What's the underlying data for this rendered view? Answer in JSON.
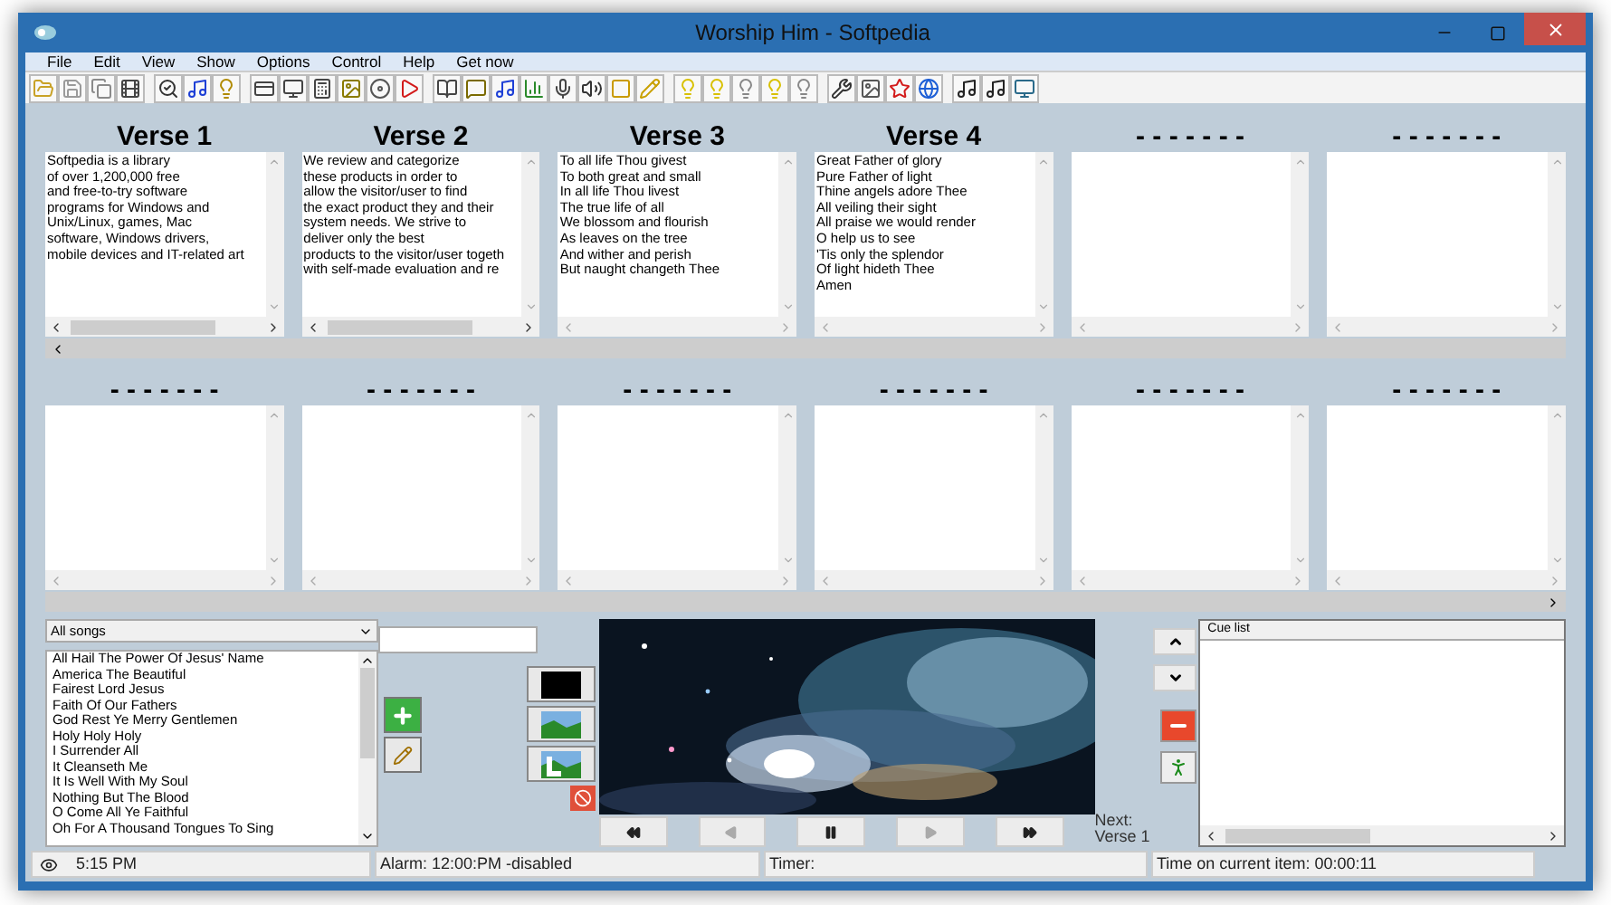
{
  "window": {
    "title": "Worship Him -  Softpedia"
  },
  "menu": [
    "File",
    "Edit",
    "View",
    "Show",
    "Options",
    "Control",
    "Help",
    "Get now"
  ],
  "verses": [
    {
      "title": "Verse 1",
      "lines": [
        "Softpedia is a library",
        "of over 1,200,000 free",
        "and free-to-try software",
        "programs for Windows and",
        "Unix/Linux, games, Mac",
        "software, Windows drivers,",
        "mobile devices and IT-related art"
      ]
    },
    {
      "title": "Verse 2",
      "lines": [
        "We review and categorize",
        "these products in order to",
        "allow the visitor/user to find",
        "the exact product they and their",
        "system needs. We strive to",
        "deliver only the best",
        "products to the visitor/user togeth",
        "with self-made evaluation and re"
      ]
    },
    {
      "title": "Verse 3",
      "lines": [
        "To all life Thou givest",
        "To both great and small",
        "In all life Thou livest",
        "The true life of all",
        "We blossom and flourish",
        "As leaves on the tree",
        "And wither and perish",
        "But naught changeth Thee"
      ]
    },
    {
      "title": "Verse 4",
      "lines": [
        "Great Father of glory",
        "Pure Father of light",
        "Thine angels adore Thee",
        "All veiling their sight",
        "All praise we would render",
        "O help us to see",
        "'Tis only the splendor",
        "Of light hideth Thee",
        "Amen"
      ]
    },
    {
      "title": "- - - - - - -"
    },
    {
      "title": "- - - - - - -"
    },
    {
      "title": "- - - - - - -"
    },
    {
      "title": "- - - - - - -"
    },
    {
      "title": "- - - - - - -"
    },
    {
      "title": "- - - - - - -"
    },
    {
      "title": "- - - - - - -"
    },
    {
      "title": "- - - - - - -"
    }
  ],
  "song_filter": {
    "value": "All songs"
  },
  "songs": [
    "All Hail The Power Of Jesus' Name",
    "America The Beautiful",
    "Fairest Lord Jesus",
    "Faith Of Our Fathers",
    "God Rest Ye Merry Gentlemen",
    "Holy Holy Holy",
    "I Surrender All",
    "It Cleanseth Me",
    "It Is Well With My Soul",
    "Nothing But The Blood",
    "O Come All Ye Faithful",
    "Oh For A Thousand Tongues To Sing"
  ],
  "transport": [
    {
      "kind": "rewind",
      "disabled": false
    },
    {
      "kind": "previous",
      "disabled": true
    },
    {
      "kind": "pause",
      "disabled": false
    },
    {
      "kind": "play",
      "disabled": true
    },
    {
      "kind": "forward",
      "disabled": false
    }
  ],
  "next": {
    "label": "Next:",
    "item": "Verse 1"
  },
  "cue_list": {
    "header": "Cue list"
  },
  "status_bar": {
    "clock": "5:15 PM",
    "alarm": "Alarm: 12:00:PM -disabled",
    "timer": "Timer:",
    "item_time": "Time on current item: 00:00:11"
  }
}
